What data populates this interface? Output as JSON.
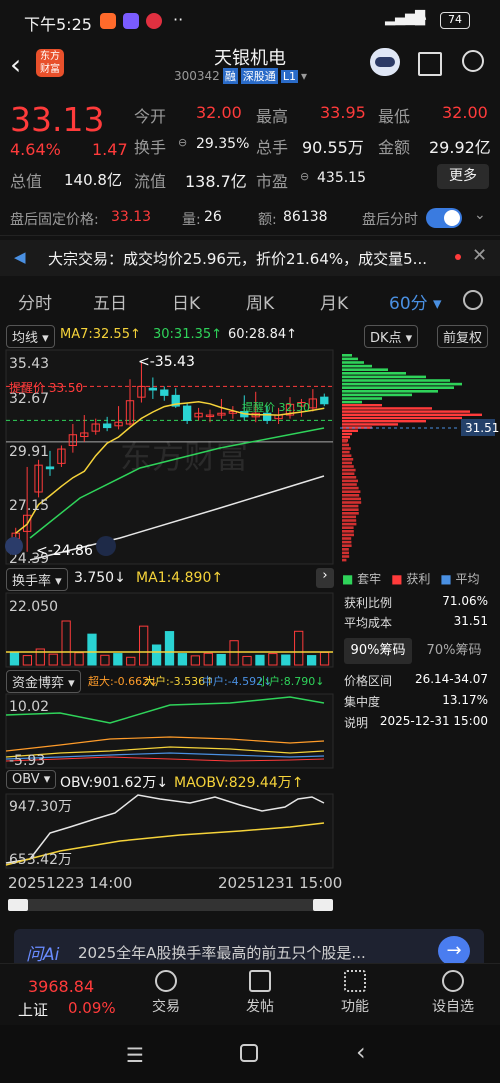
{
  "status": {
    "time": "下午5:25",
    "battery": "74"
  },
  "header": {
    "logo_top": "东方",
    "logo_bottom": "财富",
    "title": "天银机电",
    "code": "300342",
    "tag_rong": "融",
    "tag_sgt": "深股通",
    "tag_l1": "L1"
  },
  "quote": {
    "price": "33.13",
    "pct": "4.64%",
    "chg": "1.47",
    "open_label": "今开",
    "open": "32.00",
    "high_label": "最高",
    "high": "33.95",
    "low_label": "最低",
    "low": "32.00",
    "turnover_label": "换手",
    "turnover": "29.35%",
    "volume_label": "总手",
    "volume": "90.55万",
    "amount_label": "金额",
    "amount": "29.92亿",
    "mktcap_label": "总值",
    "mktcap": "140.8亿",
    "float_label": "流值",
    "float": "138.7亿",
    "pe_label": "市盈",
    "pe": "435.15",
    "more": "更多"
  },
  "after_hours": {
    "price_label": "盘后固定价格:",
    "price": "33.13",
    "vol_label": "量:",
    "vol": "26",
    "amt_label": "额:",
    "amt": "86138",
    "toggle_label": "盘后分时"
  },
  "notice": {
    "text": "大宗交易：成交均价25.96元，折价21.64%，成交量5..."
  },
  "tabs": [
    "分时",
    "五日",
    "日K",
    "周K",
    "月K",
    "60分"
  ],
  "chart": {
    "ma_selector": "均线",
    "ma7": "MA7:32.55↑",
    "ma30": "30:31.35↑",
    "ma60": "60:28.84↑",
    "dk_label": "DK点",
    "fq_label": "前复权",
    "y_labels": [
      "35.43",
      "32.67",
      "29.91",
      "27.15",
      "24.39"
    ],
    "high_mark": "<-35.43",
    "low_mark": "<-24.86",
    "tip_label": "提醒价 33.50",
    "support_label": "提醒价 32.50",
    "watermark": "东方财富",
    "start_date": "20251223 14:00",
    "end_date": "20251231 15:00",
    "candles": [
      {
        "o": 25.6,
        "c": 25.9,
        "h": 26.2,
        "l": 24.9
      },
      {
        "o": 26.0,
        "c": 26.9,
        "h": 29.6,
        "l": 24.86
      },
      {
        "o": 28.2,
        "c": 29.7,
        "h": 30.0,
        "l": 27.9
      },
      {
        "o": 29.6,
        "c": 29.5,
        "h": 30.5,
        "l": 29.1
      },
      {
        "o": 29.8,
        "c": 30.6,
        "h": 30.8,
        "l": 29.6
      },
      {
        "o": 30.8,
        "c": 31.4,
        "h": 32.0,
        "l": 30.4
      },
      {
        "o": 31.3,
        "c": 31.5,
        "h": 32.5,
        "l": 31.0
      },
      {
        "o": 31.6,
        "c": 32.0,
        "h": 32.3,
        "l": 31.4
      },
      {
        "o": 32.0,
        "c": 31.8,
        "h": 32.4,
        "l": 31.6
      },
      {
        "o": 31.9,
        "c": 32.1,
        "h": 33.0,
        "l": 31.7
      },
      {
        "o": 32.0,
        "c": 33.3,
        "h": 34.5,
        "l": 31.9
      },
      {
        "o": 33.5,
        "c": 34.1,
        "h": 35.43,
        "l": 33.2
      },
      {
        "o": 34.0,
        "c": 33.9,
        "h": 34.6,
        "l": 33.4
      },
      {
        "o": 33.9,
        "c": 33.6,
        "h": 34.1,
        "l": 33.3
      },
      {
        "o": 33.6,
        "c": 33.0,
        "h": 34.0,
        "l": 32.9
      },
      {
        "o": 33.0,
        "c": 32.2,
        "h": 33.2,
        "l": 32.0
      },
      {
        "o": 32.4,
        "c": 32.6,
        "h": 32.9,
        "l": 32.2
      },
      {
        "o": 32.5,
        "c": 32.5,
        "h": 32.8,
        "l": 32.1
      },
      {
        "o": 32.5,
        "c": 32.6,
        "h": 33.4,
        "l": 32.3
      },
      {
        "o": 32.6,
        "c": 32.7,
        "h": 33.0,
        "l": 32.3
      },
      {
        "o": 32.7,
        "c": 32.4,
        "h": 33.6,
        "l": 32.2
      },
      {
        "o": 32.4,
        "c": 32.6,
        "h": 33.8,
        "l": 32.1
      },
      {
        "o": 32.6,
        "c": 32.2,
        "h": 33.0,
        "l": 32.0
      },
      {
        "o": 32.3,
        "c": 32.5,
        "h": 32.9,
        "l": 32.0
      },
      {
        "o": 32.5,
        "c": 33.1,
        "h": 33.5,
        "l": 32.3
      },
      {
        "o": 33.0,
        "c": 33.2,
        "h": 33.4,
        "l": 32.4
      },
      {
        "o": 32.9,
        "c": 33.4,
        "h": 33.95,
        "l": 32.7
      },
      {
        "o": 33.5,
        "c": 33.13,
        "h": 33.7,
        "l": 33.0
      }
    ]
  },
  "chip_panel": {
    "legend": [
      "套牢",
      "获利",
      "平均"
    ],
    "avg_price": "31.51",
    "profit_ratio_label": "获利比例",
    "profit_ratio": "71.06%",
    "avg_cost_label": "平均成本",
    "avg_cost": "31.51",
    "tab90": "90%筹码",
    "tab70": "70%筹码",
    "range_label": "价格区间",
    "range": "26.14-34.07",
    "concentration_label": "集中度",
    "concentration": "13.17%",
    "note_label": "说明",
    "note": "2025-12-31 15:00"
  },
  "turnover": {
    "label": "换手率",
    "value": "3.750↓",
    "ma": "MA1:4.890↑",
    "top": "22.050",
    "bars": [
      {
        "v": 4.2,
        "up": false
      },
      {
        "v": 3.3,
        "up": true
      },
      {
        "v": 5.6,
        "up": true
      },
      {
        "v": 3.8,
        "up": true
      },
      {
        "v": 15.4,
        "up": true
      },
      {
        "v": 4.3,
        "up": true
      },
      {
        "v": 10.8,
        "up": false
      },
      {
        "v": 3.4,
        "up": true
      },
      {
        "v": 4.0,
        "up": false
      },
      {
        "v": 2.7,
        "up": true
      },
      {
        "v": 13.6,
        "up": true
      },
      {
        "v": 7.0,
        "up": false
      },
      {
        "v": 11.7,
        "up": false
      },
      {
        "v": 4.0,
        "up": false
      },
      {
        "v": 3.2,
        "up": true
      },
      {
        "v": 4.1,
        "up": true
      },
      {
        "v": 3.7,
        "up": false
      },
      {
        "v": 8.5,
        "up": true
      },
      {
        "v": 3.0,
        "up": true
      },
      {
        "v": 3.4,
        "up": false
      },
      {
        "v": 4.0,
        "up": true
      },
      {
        "v": 3.5,
        "up": false
      },
      {
        "v": 11.8,
        "up": true
      },
      {
        "v": 3.3,
        "up": false
      },
      {
        "v": 4.4,
        "up": true
      }
    ]
  },
  "fund": {
    "label": "资金博弈",
    "super": "超大:-0.662↓",
    "large": "大户:-3.536↑",
    "mid": "中户:-4.592↓",
    "small": "小户:8.790↓",
    "top": "10.02",
    "bottom": "-5.93"
  },
  "obv": {
    "label": "OBV",
    "value": "OBV:901.62万↓",
    "ma": "MAOBV:829.44万↑",
    "top": "947.30万",
    "bottom": "653.42万"
  },
  "ai": {
    "brand": "问Ai",
    "text": "2025全年A股换手率最高的前五只个股是..."
  },
  "bottom": {
    "index": "3968.84",
    "index_name": "上证",
    "index_pct": "0.09%",
    "items": [
      "交易",
      "发帖",
      "功能",
      "设自选"
    ]
  },
  "colors": {
    "up": "#ff3b3b",
    "down": "#2ad3d3",
    "accent": "#4a90e2"
  }
}
